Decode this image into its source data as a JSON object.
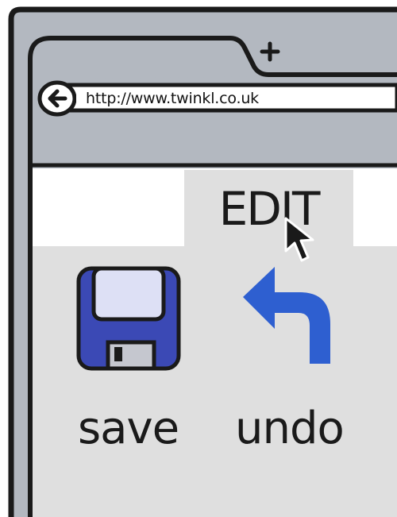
{
  "browser": {
    "address_bar": {
      "url": "http://www.twinkl.co.uk"
    },
    "back_button": {
      "icon": "back-arrow-icon"
    },
    "new_tab_button": {
      "icon": "plus-icon"
    }
  },
  "menu": {
    "active_tab": {
      "label": "EDIT"
    }
  },
  "toolbar": {
    "items": [
      {
        "label": "save",
        "icon": "floppy-disk-icon"
      },
      {
        "label": "undo",
        "icon": "undo-arrow-icon"
      }
    ]
  },
  "colors": {
    "chrome_gray": "#b3b8c0",
    "content_gray": "#dfdfdf",
    "floppy_blue": "#3b49b5",
    "undo_blue": "#2e5fd0",
    "outline": "#1a1a1a"
  }
}
